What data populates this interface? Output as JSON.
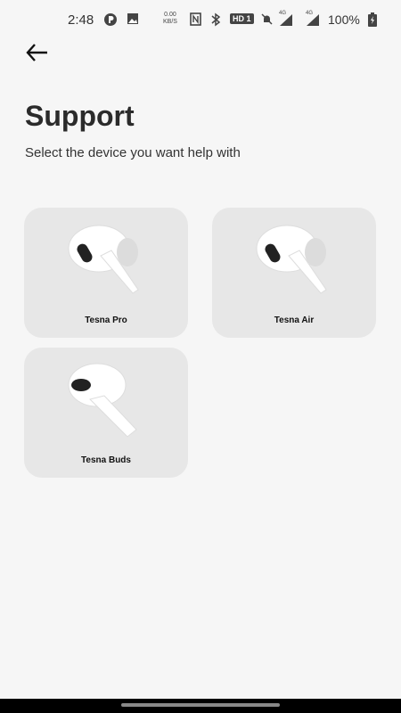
{
  "status_bar": {
    "time": "2:48",
    "net_speed": "0.00",
    "net_unit": "KB/S",
    "hd_badge": "HD 1",
    "signal_1": "4G",
    "signal_2": "4G",
    "battery": "100%"
  },
  "header": {
    "back_icon": "arrow-left-icon",
    "title": "Support",
    "subtitle": "Select the device you want help with"
  },
  "devices": [
    {
      "label": "Tesna Pro",
      "icon": "earbud-pro-image"
    },
    {
      "label": "Tesna Air",
      "icon": "earbud-air-image"
    },
    {
      "label": "Tesna Buds",
      "icon": "earbud-buds-image"
    }
  ]
}
